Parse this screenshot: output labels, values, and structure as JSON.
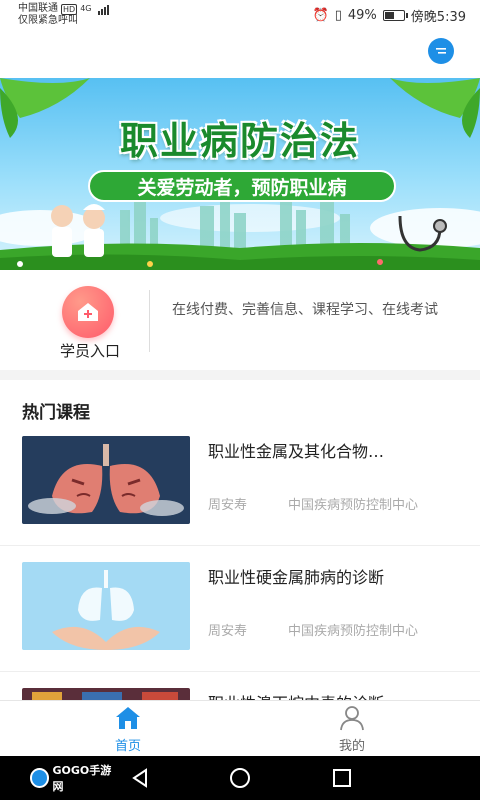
{
  "status_bar": {
    "carrier": "中国联通",
    "hd": "HD",
    "network": "4G",
    "emergency": "仅限紧急呼叫",
    "battery": "49%",
    "time": "傍晚5:39"
  },
  "banner": {
    "title": "职业病防治法",
    "subtitle": "关爱劳动者，预防职业病"
  },
  "entry": {
    "label": "学员入口",
    "description": "在线付费、完善信息、课程学习、在线考试"
  },
  "section": {
    "title": "热门课程"
  },
  "courses": [
    {
      "title": "职业性金属及其化合物…",
      "author": "周安寿",
      "org": "中国疾病预防控制中心"
    },
    {
      "title": "职业性硬金属肺病的诊断",
      "author": "周安寿",
      "org": "中国疾病预防控制中心"
    },
    {
      "title": "职业性溴丙烷中毒的诊断",
      "author": "",
      "org": ""
    }
  ],
  "bottom_nav": {
    "home": "首页",
    "mine": "我的"
  },
  "watermark": "GOGO手游网",
  "colors": {
    "accent": "#1e8fe6",
    "banner_green": "#2ea836",
    "entry_icon": "#ff5a6a"
  },
  "icons": {
    "chat": "chat-bubble-icon",
    "entry": "house-plus-icon",
    "home": "home-icon",
    "mine": "person-icon"
  }
}
